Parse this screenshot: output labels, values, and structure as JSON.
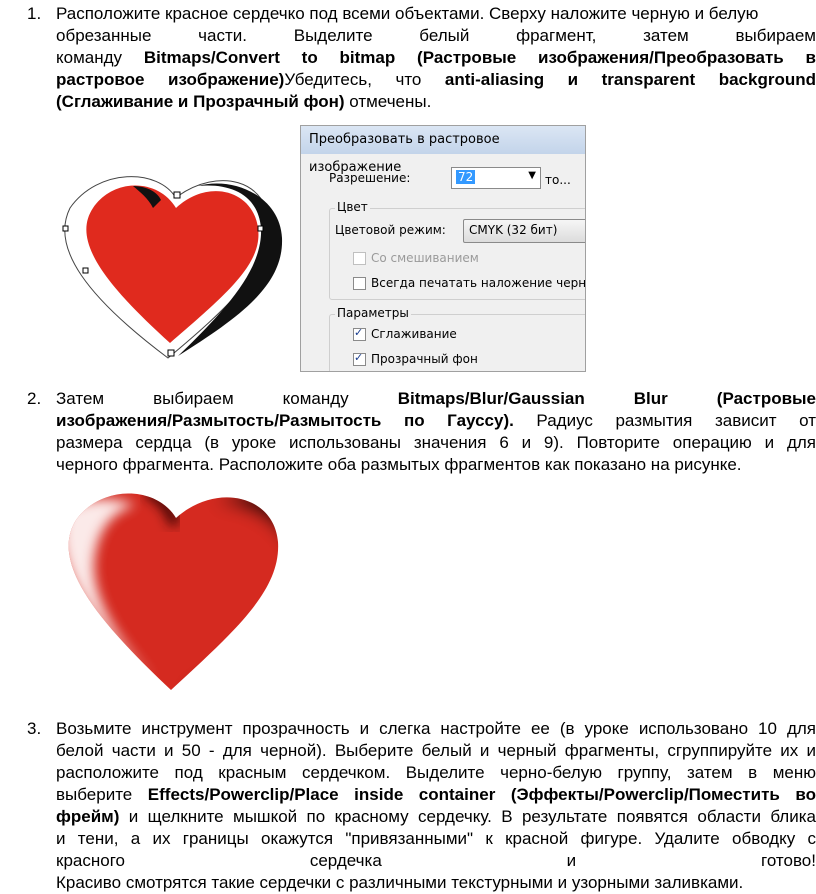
{
  "steps": [
    {
      "number": "1.",
      "lines": [
        "Расположите красное сердечко под всеми объектами. Сверху наложите черную и белую",
        "обрезанные части. Выделите белый фрагмент, затем выбираем",
        "команду Bitmaps/Convert to bitmap (Растровые изображения/Преобразовать в",
        "растровое изображение)Убедитесь, что anti-aliasing и transparent background",
        "(Сглаживание и Прозрачный фон) отмечены."
      ]
    },
    {
      "number": "2.",
      "lines": [
        "Затем выбираем команду Bitmaps/Blur/Gaussian Blur (Растровые",
        "изображения/Размытость/Размытость по Гауссу). Радиус размытия зависит от",
        "размера сердца (в уроке использованы значения 6 и 9). Повторите операцию и для",
        "черного фрагмента. Расположите оба размытых фрагментов как показано на рисунке."
      ]
    },
    {
      "number": "3.",
      "lines": [
        "Возьмите инструмент прозрачность и слегка настройте ее (в уроке использовано 10 для",
        "белой части и 50 - для черной). Выберите белый и черный фрагменты, сгруппируйте их и",
        "расположите под красным сердечком. Выделите черно-белую группу, затем в меню",
        "выберите Effects/Powerclip/Place inside container (Эффекты/Powerclip/Поместить во",
        "фрейм) и щелкните мышкой по красному сердечку. В результате появятся области блика",
        "и тени, а их границы окажутся \"привязанными\" к красной фигуре. Удалите обводку с",
        "красного сердечка и готово!",
        "Красиво смотрятся такие сердечки с различными текстурными и узорными заливками."
      ]
    }
  ],
  "dialog": {
    "title": "Преобразовать в растровое изображение",
    "resolution_label": "Разрешение:",
    "resolution_value": "72",
    "resolution_suffix": "то...",
    "color_group": "Цвет",
    "color_mode_label": "Цветовой режим:",
    "color_mode_value": "CMYK (32 бит)",
    "dithering": "Со смешиванием",
    "overprint": "Всегда печатать наложение черного",
    "params_group": "Параметры",
    "antialias": "Сглаживание",
    "antialias_checked": true,
    "transparent": "Прозрачный фон",
    "transparent_checked": true
  },
  "colors": {
    "heart_red": "#e02a1e",
    "shadow_black": "#111111",
    "dialog_bg": "#f0f0f0",
    "highlight": "#3399ff"
  }
}
